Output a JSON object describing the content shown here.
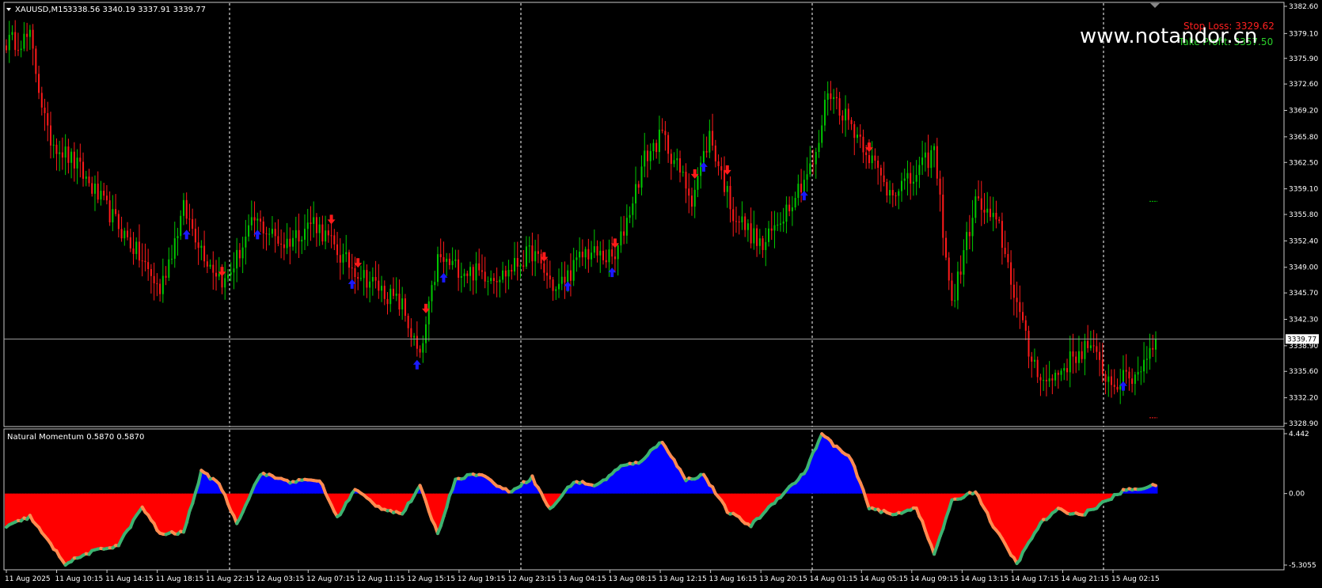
{
  "symbol_header": "XAUUSD,M15",
  "ohlc_header": "3338.56 3340.19 3337.91 3339.77",
  "watermark": "www.notandor.cn",
  "stop_loss_label": "Stop Loss: 3329.62",
  "take_profit_label": "Take Profit: 3357.50",
  "current_price_label": "3339.77",
  "indicator_title": "Natural Momentum 0.5870 0.5870",
  "colors": {
    "background": "#000000",
    "bull_candle": "#00c800",
    "bear_candle": "#ff1a1a",
    "buy_arrow": "#1a1aff",
    "sell_arrow": "#ff1a1a",
    "momentum_positive_fill": "#0000ff",
    "momentum_negative_fill": "#ff0000",
    "momentum_line_up": "#3cb371",
    "momentum_line_down": "#ff8c50",
    "grid_vertical": "#ffffff",
    "price_line": "#a0a0a0"
  },
  "chart_data": [
    {
      "type": "candlestick",
      "title": "XAUUSD,M15",
      "ylim": [
        3328.9,
        3382.6
      ],
      "price_axis_ticks": [
        "3382.60",
        "3379.10",
        "3375.90",
        "3372.60",
        "3369.20",
        "3365.80",
        "3362.50",
        "3359.10",
        "3355.80",
        "3352.40",
        "3349.00",
        "3345.70",
        "3342.30",
        "3338.90",
        "3335.60",
        "3332.20",
        "3328.90"
      ],
      "time_axis_ticks": [
        "11 Aug 2025",
        "11 Aug 10:15",
        "11 Aug 14:15",
        "11 Aug 18:15",
        "11 Aug 22:15",
        "12 Aug 03:15",
        "12 Aug 07:15",
        "12 Aug 11:15",
        "12 Aug 15:15",
        "12 Aug 19:15",
        "12 Aug 23:15",
        "13 Aug 04:15",
        "13 Aug 08:15",
        "13 Aug 12:15",
        "13 Aug 16:15",
        "13 Aug 20:15",
        "14 Aug 01:15",
        "14 Aug 05:15",
        "14 Aug 09:15",
        "14 Aug 13:15",
        "14 Aug 17:15",
        "14 Aug 21:15",
        "15 Aug 02:15"
      ],
      "close_path_keypoints": [
        {
          "i": 0,
          "v": 3378.0
        },
        {
          "i": 8,
          "v": 3378.5
        },
        {
          "i": 14,
          "v": 3366.0
        },
        {
          "i": 24,
          "v": 3362.0
        },
        {
          "i": 34,
          "v": 3356.5
        },
        {
          "i": 44,
          "v": 3351.0
        },
        {
          "i": 52,
          "v": 3346.0
        },
        {
          "i": 60,
          "v": 3356.5
        },
        {
          "i": 68,
          "v": 3350.0
        },
        {
          "i": 74,
          "v": 3347.0
        },
        {
          "i": 84,
          "v": 3355.0
        },
        {
          "i": 94,
          "v": 3352.0
        },
        {
          "i": 104,
          "v": 3355.0
        },
        {
          "i": 114,
          "v": 3350.0
        },
        {
          "i": 124,
          "v": 3347.0
        },
        {
          "i": 134,
          "v": 3344.0
        },
        {
          "i": 140,
          "v": 3337.0
        },
        {
          "i": 146,
          "v": 3350.0
        },
        {
          "i": 156,
          "v": 3348.5
        },
        {
          "i": 168,
          "v": 3348.0
        },
        {
          "i": 178,
          "v": 3351.0
        },
        {
          "i": 186,
          "v": 3346.0
        },
        {
          "i": 196,
          "v": 3351.0
        },
        {
          "i": 206,
          "v": 3350.0
        },
        {
          "i": 216,
          "v": 3363.0
        },
        {
          "i": 222,
          "v": 3366.0
        },
        {
          "i": 232,
          "v": 3358.0
        },
        {
          "i": 238,
          "v": 3366.0
        },
        {
          "i": 246,
          "v": 3356.0
        },
        {
          "i": 256,
          "v": 3351.5
        },
        {
          "i": 266,
          "v": 3358.0
        },
        {
          "i": 274,
          "v": 3363.0
        },
        {
          "i": 278,
          "v": 3372.0
        },
        {
          "i": 290,
          "v": 3365.0
        },
        {
          "i": 298,
          "v": 3359.0
        },
        {
          "i": 306,
          "v": 3360.0
        },
        {
          "i": 314,
          "v": 3364.0
        },
        {
          "i": 320,
          "v": 3344.0
        },
        {
          "i": 328,
          "v": 3357.5
        },
        {
          "i": 336,
          "v": 3354.0
        },
        {
          "i": 346,
          "v": 3338.0
        },
        {
          "i": 352,
          "v": 3334.0
        },
        {
          "i": 360,
          "v": 3337.0
        },
        {
          "i": 366,
          "v": 3339.0
        },
        {
          "i": 374,
          "v": 3334.0
        },
        {
          "i": 382,
          "v": 3335.0
        },
        {
          "i": 389,
          "v": 3339.77
        }
      ],
      "buy_arrows_at": [
        61,
        85,
        117,
        139,
        148,
        190,
        205,
        236,
        270,
        378
      ],
      "sell_arrows_at": [
        73,
        110,
        119,
        142,
        182,
        206,
        233,
        244,
        292
      ],
      "current_price": 3339.77,
      "stop_loss": 3329.62,
      "take_profit": 3357.5
    },
    {
      "type": "area",
      "title": "Natural Momentum 0.5870 0.5870",
      "ylim": [
        -5.3055,
        4.442
      ],
      "price_axis_ticks": [
        "4.442",
        "0.00",
        "-5.3055"
      ],
      "keypoints": [
        {
          "i": 0,
          "v": -2.5
        },
        {
          "i": 8,
          "v": -1.7
        },
        {
          "i": 14,
          "v": -3.5
        },
        {
          "i": 20,
          "v": -5.2
        },
        {
          "i": 28,
          "v": -4.4
        },
        {
          "i": 38,
          "v": -3.8
        },
        {
          "i": 46,
          "v": -1.0
        },
        {
          "i": 52,
          "v": -3.0
        },
        {
          "i": 60,
          "v": -2.9
        },
        {
          "i": 66,
          "v": 1.6
        },
        {
          "i": 72,
          "v": 0.8
        },
        {
          "i": 78,
          "v": -2.2
        },
        {
          "i": 86,
          "v": 1.5
        },
        {
          "i": 96,
          "v": 0.9
        },
        {
          "i": 106,
          "v": 1.0
        },
        {
          "i": 112,
          "v": -1.8
        },
        {
          "i": 118,
          "v": 0.3
        },
        {
          "i": 126,
          "v": -1.0
        },
        {
          "i": 134,
          "v": -1.5
        },
        {
          "i": 140,
          "v": 0.5
        },
        {
          "i": 146,
          "v": -3.0
        },
        {
          "i": 152,
          "v": 1.1
        },
        {
          "i": 160,
          "v": 1.5
        },
        {
          "i": 170,
          "v": 0.1
        },
        {
          "i": 178,
          "v": 1.2
        },
        {
          "i": 184,
          "v": -1.2
        },
        {
          "i": 192,
          "v": 0.9
        },
        {
          "i": 200,
          "v": 0.6
        },
        {
          "i": 208,
          "v": 2.0
        },
        {
          "i": 214,
          "v": 2.3
        },
        {
          "i": 222,
          "v": 3.9
        },
        {
          "i": 230,
          "v": 1.0
        },
        {
          "i": 236,
          "v": 1.4
        },
        {
          "i": 244,
          "v": -1.3
        },
        {
          "i": 252,
          "v": -2.4
        },
        {
          "i": 260,
          "v": -0.6
        },
        {
          "i": 270,
          "v": 1.5
        },
        {
          "i": 276,
          "v": 4.4
        },
        {
          "i": 286,
          "v": 2.5
        },
        {
          "i": 292,
          "v": -1.0
        },
        {
          "i": 300,
          "v": -1.6
        },
        {
          "i": 308,
          "v": -1.0
        },
        {
          "i": 314,
          "v": -4.5
        },
        {
          "i": 320,
          "v": -0.6
        },
        {
          "i": 328,
          "v": 0.2
        },
        {
          "i": 334,
          "v": -2.4
        },
        {
          "i": 342,
          "v": -5.2
        },
        {
          "i": 350,
          "v": -2.2
        },
        {
          "i": 356,
          "v": -1.2
        },
        {
          "i": 364,
          "v": -1.6
        },
        {
          "i": 372,
          "v": -0.6
        },
        {
          "i": 378,
          "v": 0.2
        },
        {
          "i": 389,
          "v": 0.59
        }
      ]
    }
  ]
}
